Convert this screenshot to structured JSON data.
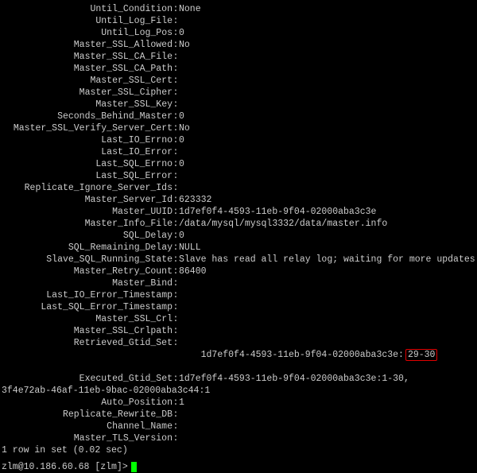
{
  "rows": [
    {
      "label": "Until_Condition",
      "value": "None"
    },
    {
      "label": "Until_Log_File",
      "value": ""
    },
    {
      "label": "Until_Log_Pos",
      "value": "0"
    },
    {
      "label": "Master_SSL_Allowed",
      "value": "No"
    },
    {
      "label": "Master_SSL_CA_File",
      "value": ""
    },
    {
      "label": "Master_SSL_CA_Path",
      "value": ""
    },
    {
      "label": "Master_SSL_Cert",
      "value": ""
    },
    {
      "label": "Master_SSL_Cipher",
      "value": ""
    },
    {
      "label": "Master_SSL_Key",
      "value": ""
    },
    {
      "label": "Seconds_Behind_Master",
      "value": "0"
    },
    {
      "label": "Master_SSL_Verify_Server_Cert",
      "value": "No"
    },
    {
      "label": "Last_IO_Errno",
      "value": "0"
    },
    {
      "label": "Last_IO_Error",
      "value": ""
    },
    {
      "label": "Last_SQL_Errno",
      "value": "0"
    },
    {
      "label": "Last_SQL_Error",
      "value": ""
    },
    {
      "label": "Replicate_Ignore_Server_Ids",
      "value": ""
    },
    {
      "label": "Master_Server_Id",
      "value": "623332"
    },
    {
      "label": "Master_UUID",
      "value": "1d7ef0f4-4593-11eb-9f04-02000aba3c3e"
    },
    {
      "label": "Master_Info_File",
      "value": "/data/mysql/mysql3332/data/master.info"
    },
    {
      "label": "SQL_Delay",
      "value": "0"
    },
    {
      "label": "SQL_Remaining_Delay",
      "value": "NULL"
    },
    {
      "label": "Slave_SQL_Running_State",
      "value": "Slave has read all relay log; waiting for more updates"
    },
    {
      "label": "Master_Retry_Count",
      "value": "86400"
    },
    {
      "label": "Master_Bind",
      "value": ""
    },
    {
      "label": "Last_IO_Error_Timestamp",
      "value": ""
    },
    {
      "label": "Last_SQL_Error_Timestamp",
      "value": ""
    },
    {
      "label": "Master_SSL_Crl",
      "value": ""
    },
    {
      "label": "Master_SSL_Crlpath",
      "value": ""
    }
  ],
  "retrieved_gtid": {
    "label": "Retrieved_Gtid_Set",
    "prefix": "1d7ef0f4-4593-11eb-9f04-02000aba3c3e:",
    "highlight": "29-30"
  },
  "executed_gtid": {
    "label": "Executed_Gtid_Set",
    "line1": "1d7ef0f4-4593-11eb-9f04-02000aba3c3e:1-30,",
    "line2": "3f4e72ab-46af-11eb-9bac-02000aba3c44:1"
  },
  "rows2": [
    {
      "label": "Auto_Position",
      "value": "1"
    },
    {
      "label": "Replicate_Rewrite_DB",
      "value": ""
    },
    {
      "label": "Channel_Name",
      "value": ""
    },
    {
      "label": "Master_TLS_Version",
      "value": ""
    }
  ],
  "footer": "1 row in set (0.02 sec)",
  "prompt": "zlm@10.186.60.68 [zlm]>"
}
